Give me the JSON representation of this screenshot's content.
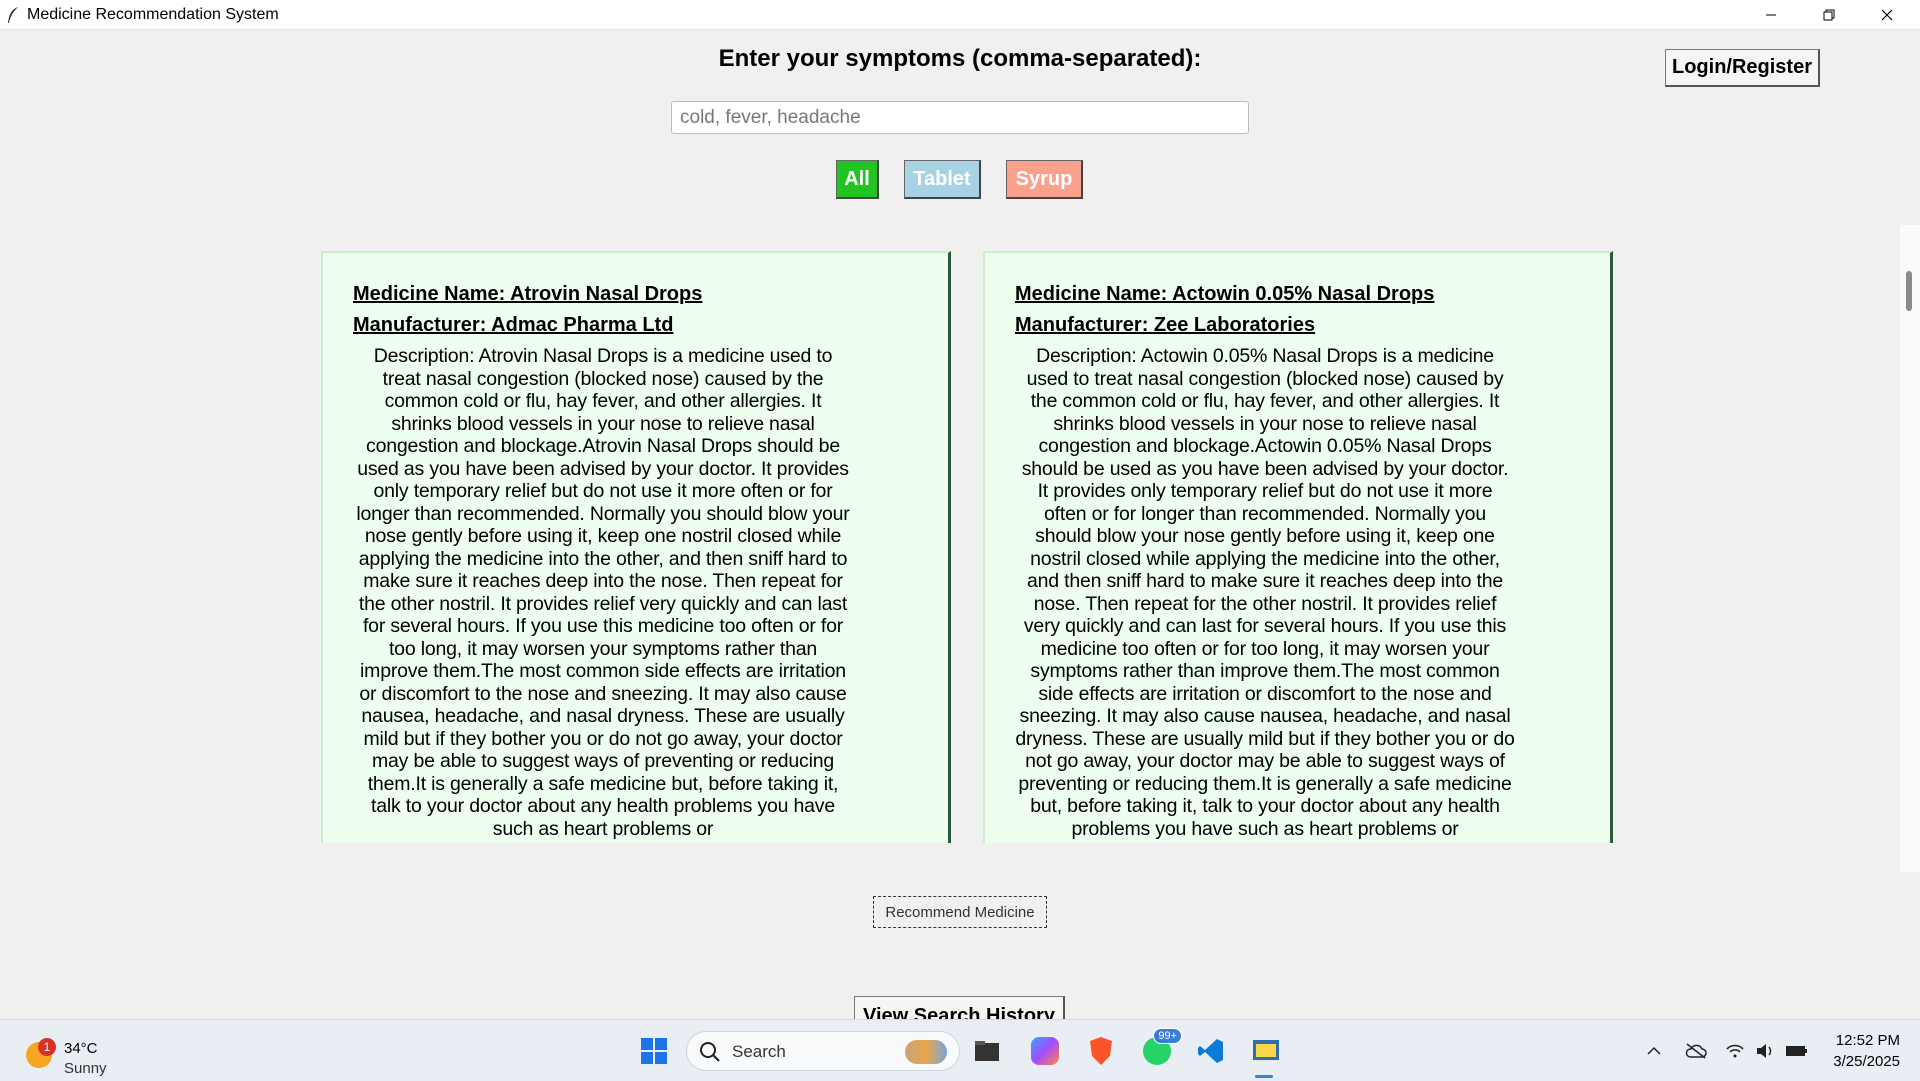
{
  "window": {
    "title": "Medicine Recommendation System"
  },
  "header": {
    "prompt_label": "Enter your symptoms (comma-separated):",
    "login_label": "Login/Register"
  },
  "search": {
    "value": "",
    "placeholder": "cold, fever, headache"
  },
  "filters": [
    {
      "label": "All",
      "color": "#22c422"
    },
    {
      "label": "Tablet",
      "color": "#a6d2e3"
    },
    {
      "label": "Syrup",
      "color": "#f9a18c"
    }
  ],
  "results": [
    {
      "name": "Medicine Name: Atrovin Nasal Drops",
      "manufacturer": "Manufacturer: Admac Pharma Ltd",
      "description": "Description: Atrovin Nasal Drops is a medicine used to treat nasal congestion (blocked nose) caused by the common cold or flu, hay fever, and other allergies. It shrinks blood vessels in your nose to relieve nasal congestion and blockage.Atrovin Nasal Drops should be used as you have been advised by your doctor. It provides only temporary relief but do not use it more often or for longer than recommended. Normally you should blow your nose gently before using it, keep one nostril closed while applying the medicine into the other, and then sniff hard to make sure it reaches deep into the nose. Then repeat for the other nostril. It provides relief very quickly and can last for several hours. If you use this medicine too often or for too long, it may worsen your symptoms rather than improve them.The most common side effects are irritation or discomfort to the nose and sneezing. It may also cause nausea, headache, and nasal dryness. These are usually mild but if they bother you or do not go away, your doctor may be able to suggest ways of preventing or reducing them.It is generally a safe medicine but, before taking it, talk to your doctor about any health problems you have such as heart problems or"
    },
    {
      "name": "Medicine Name: Actowin 0.05% Nasal Drops",
      "manufacturer": "Manufacturer: Zee Laboratories",
      "description": "Description: Actowin 0.05% Nasal Drops is a medicine used to treat nasal congestion (blocked nose) caused by the common cold or flu, hay fever, and other allergies. It shrinks blood vessels in your nose to relieve nasal congestion and blockage.Actowin 0.05% Nasal Drops should be used as you have been advised by your doctor. It provides only temporary relief but do not use it more often or for longer than recommended. Normally you should blow your nose gently before using it, keep one nostril closed while applying the medicine into the other, and then sniff hard to make sure it reaches deep into the nose. Then repeat for the other nostril. It provides relief very quickly and can last for several hours. If you use this medicine too often or for too long, it may worsen your symptoms rather than improve them.The most common side effects are irritation or discomfort to the nose and sneezing. It may also cause nausea, headache, and nasal dryness. These are usually mild but if they bother you or do not go away, your doctor may be able to suggest ways of preventing or reducing them.It is generally a safe medicine but, before taking it, talk to your doctor about any health problems you have such as heart problems or"
    }
  ],
  "actions": {
    "recommend_label": "Recommend Medicine",
    "history_label": "View Search History"
  },
  "taskbar": {
    "weather_temp": "34°C",
    "weather_condition": "Sunny",
    "weather_badge": "1",
    "search_label": "Search",
    "whatsapp_badge": "99+",
    "time": "12:52 PM",
    "date": "3/25/2025",
    "icons": [
      "start-icon",
      "search-icon",
      "file-explorer-icon",
      "copilot-icon",
      "brave-browser-icon",
      "whatsapp-icon",
      "vscode-icon",
      "python-app-icon"
    ]
  }
}
